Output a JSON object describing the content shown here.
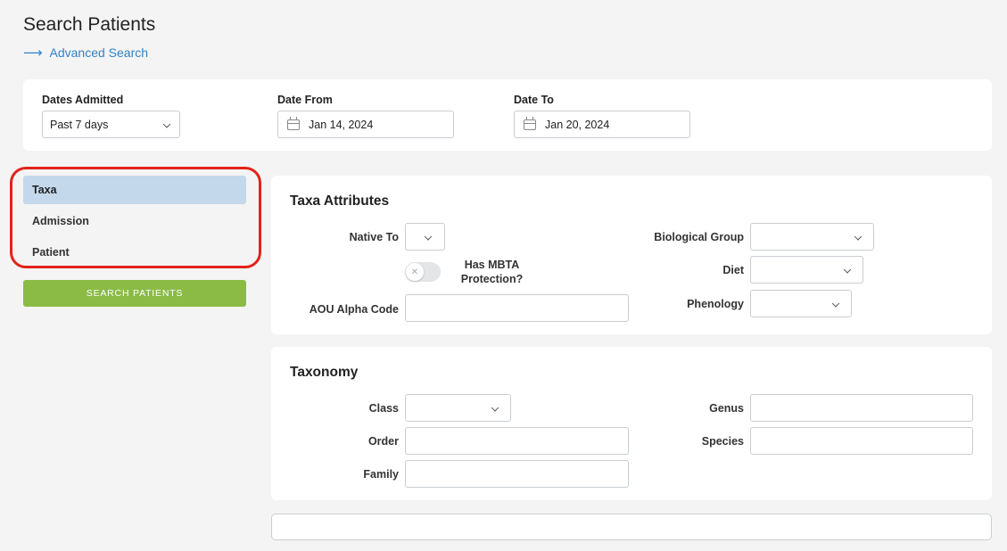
{
  "header": {
    "title": "Search Patients",
    "advanced_link": "Advanced Search"
  },
  "dates": {
    "dates_admitted_label": "Dates Admitted",
    "dates_admitted_value": "Past 7 days",
    "date_from_label": "Date From",
    "date_from_value": "Jan 14, 2024",
    "date_to_label": "Date To",
    "date_to_value": "Jan 20, 2024"
  },
  "sidebar": {
    "items": [
      {
        "label": "Taxa",
        "active": true
      },
      {
        "label": "Admission",
        "active": false
      },
      {
        "label": "Patient",
        "active": false
      }
    ],
    "search_button": "SEARCH PATIENTS"
  },
  "taxa_attributes": {
    "title": "Taxa Attributes",
    "native_to_label": "Native To",
    "native_to_value": "",
    "mbta_label_line1": "Has MBTA",
    "mbta_label_line2": "Protection?",
    "mbta_checked": false,
    "aou_label": "AOU Alpha Code",
    "aou_value": "",
    "biological_group_label": "Biological Group",
    "biological_group_value": "",
    "diet_label": "Diet",
    "diet_value": "",
    "phenology_label": "Phenology",
    "phenology_value": ""
  },
  "taxonomy": {
    "title": "Taxonomy",
    "class_label": "Class",
    "class_value": "",
    "order_label": "Order",
    "order_value": "",
    "family_label": "Family",
    "family_value": "",
    "genus_label": "Genus",
    "genus_value": "",
    "species_label": "Species",
    "species_value": ""
  },
  "colors": {
    "link": "#2f83c9",
    "active_nav": "#c3d8ea",
    "search_button": "#8bbb45",
    "annotation_ring": "#e2231a"
  },
  "icons": {
    "advanced_link": "arrow-right-icon",
    "date": "calendar-icon",
    "select": "chevron-down-icon",
    "toggle": "x-icon"
  }
}
